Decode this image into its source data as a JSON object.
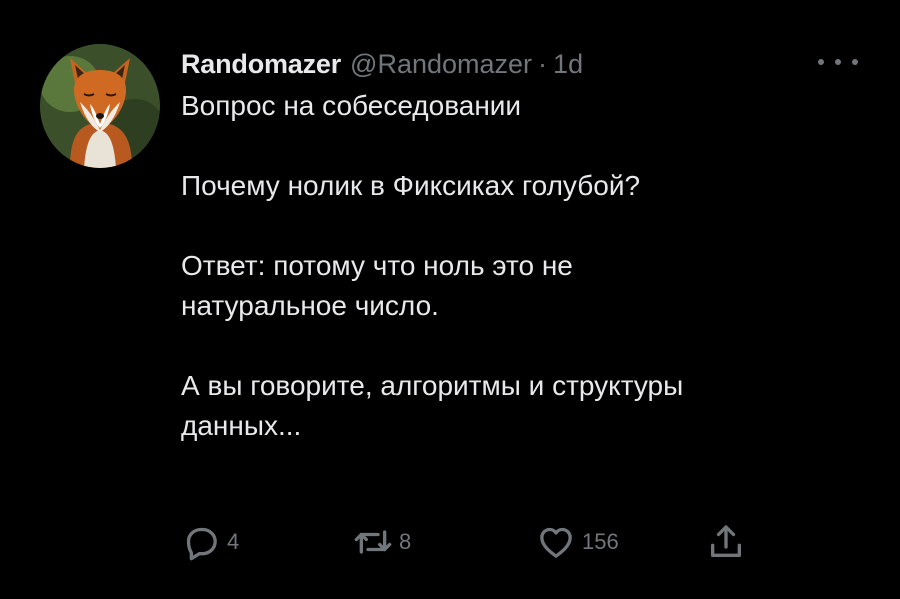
{
  "tweet": {
    "author": {
      "display_name": "Randomazer",
      "handle": "@Randomazer",
      "separator": "·",
      "time": "1d",
      "avatar_icon": "fox-avatar"
    },
    "more_icon": "more-horizontal-icon",
    "paragraphs": [
      [
        "Вопрос на собеседовании"
      ],
      [
        "Почему нолик в Фиксиках голубой?"
      ],
      [
        "Ответ: потому что ноль это не",
        "натуральное число."
      ],
      [
        "А вы говорите, алгоритмы и структуры",
        "данных..."
      ]
    ],
    "actions": {
      "reply_count": "4",
      "retweet_count": "8",
      "like_count": "156"
    }
  },
  "colors": {
    "background": "#000000",
    "text_primary": "#e7e9ea",
    "text_secondary": "#71767b"
  }
}
